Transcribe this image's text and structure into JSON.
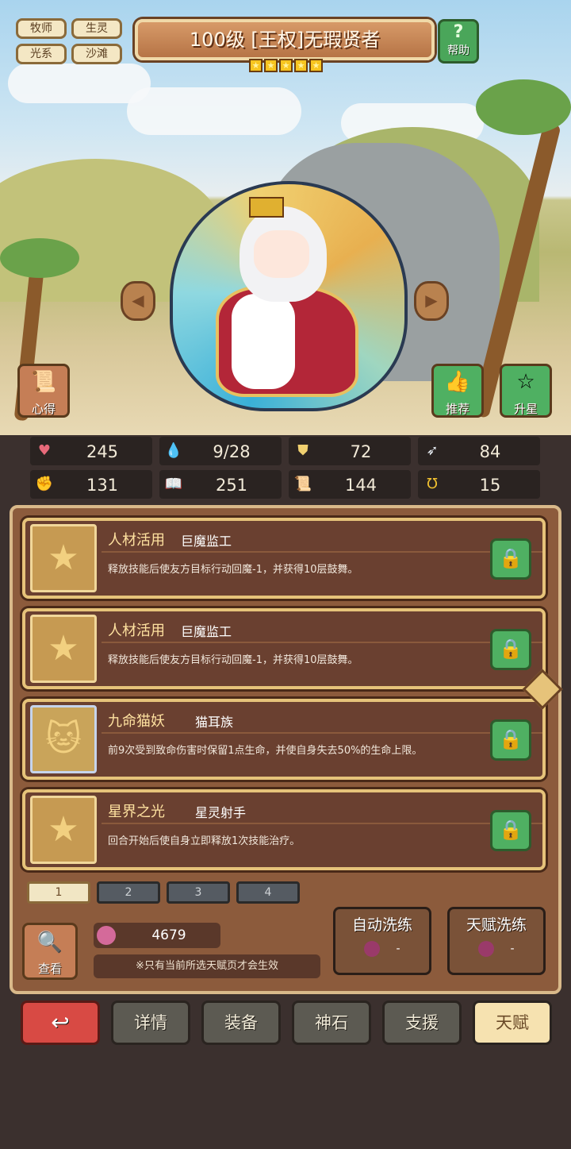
{
  "tags": [
    "牧师",
    "生灵",
    "光系",
    "沙滩"
  ],
  "hero": {
    "title": "100级  [王权]无瑕贤者",
    "stars": 5
  },
  "help": {
    "icon": "question-mark-icon",
    "label": "帮助"
  },
  "side_buttons": {
    "notes": "心得",
    "recommend": "推荐",
    "upgrade_star": "升星"
  },
  "stats": [
    {
      "icon": "heart-icon",
      "value": "245",
      "color": "#e86a7a"
    },
    {
      "icon": "water-drop-icon",
      "value": "9/28",
      "color": "#4ab0e8"
    },
    {
      "icon": "shield-icon",
      "value": "72",
      "color": "#f0d070"
    },
    {
      "icon": "wing-icon",
      "value": "84",
      "color": "#e8eef4"
    },
    {
      "icon": "fist-icon",
      "value": "131",
      "color": "#f0b0a0"
    },
    {
      "icon": "book-icon",
      "value": "251",
      "color": "#e06a6a"
    },
    {
      "icon": "scroll-icon",
      "value": "144",
      "color": "#5a8ae0"
    },
    {
      "icon": "horseshoe-icon",
      "value": "15",
      "color": "#f0c030"
    }
  ],
  "talents": [
    {
      "name": "人材活用",
      "source": "巨魔监工",
      "desc": "释放技能后使友方目标行动回魔-1，并获得10层鼓舞。",
      "icon": "star-icon"
    },
    {
      "name": "人材活用",
      "source": "巨魔监工",
      "desc": "释放技能后使友方目标行动回魔-1，并获得10层鼓舞。",
      "icon": "star-icon"
    },
    {
      "name": "九命猫妖",
      "source": "猫耳族",
      "desc": "前9次受到致命伤害时保留1点生命，并使自身失去50%的生命上限。",
      "icon": "cat-face-icon"
    },
    {
      "name": "星界之光",
      "source": "星灵射手",
      "desc": "回合开始后使自身立即释放1次技能治疗。",
      "icon": "star-icon"
    }
  ],
  "pages": [
    "1",
    "2",
    "3",
    "4"
  ],
  "view": {
    "label": "查看"
  },
  "currency": {
    "value": "4679"
  },
  "notice": "※只有当前所选天赋页才会生效",
  "wash": {
    "auto": "自动洗练",
    "talent": "天赋洗练",
    "auto_cost": "-",
    "talent_cost": "-"
  },
  "nav": {
    "back_icon": "return-arrow-icon",
    "details": "详情",
    "equipment": "装备",
    "godstone": "神石",
    "support": "支援",
    "talent": "天赋"
  }
}
